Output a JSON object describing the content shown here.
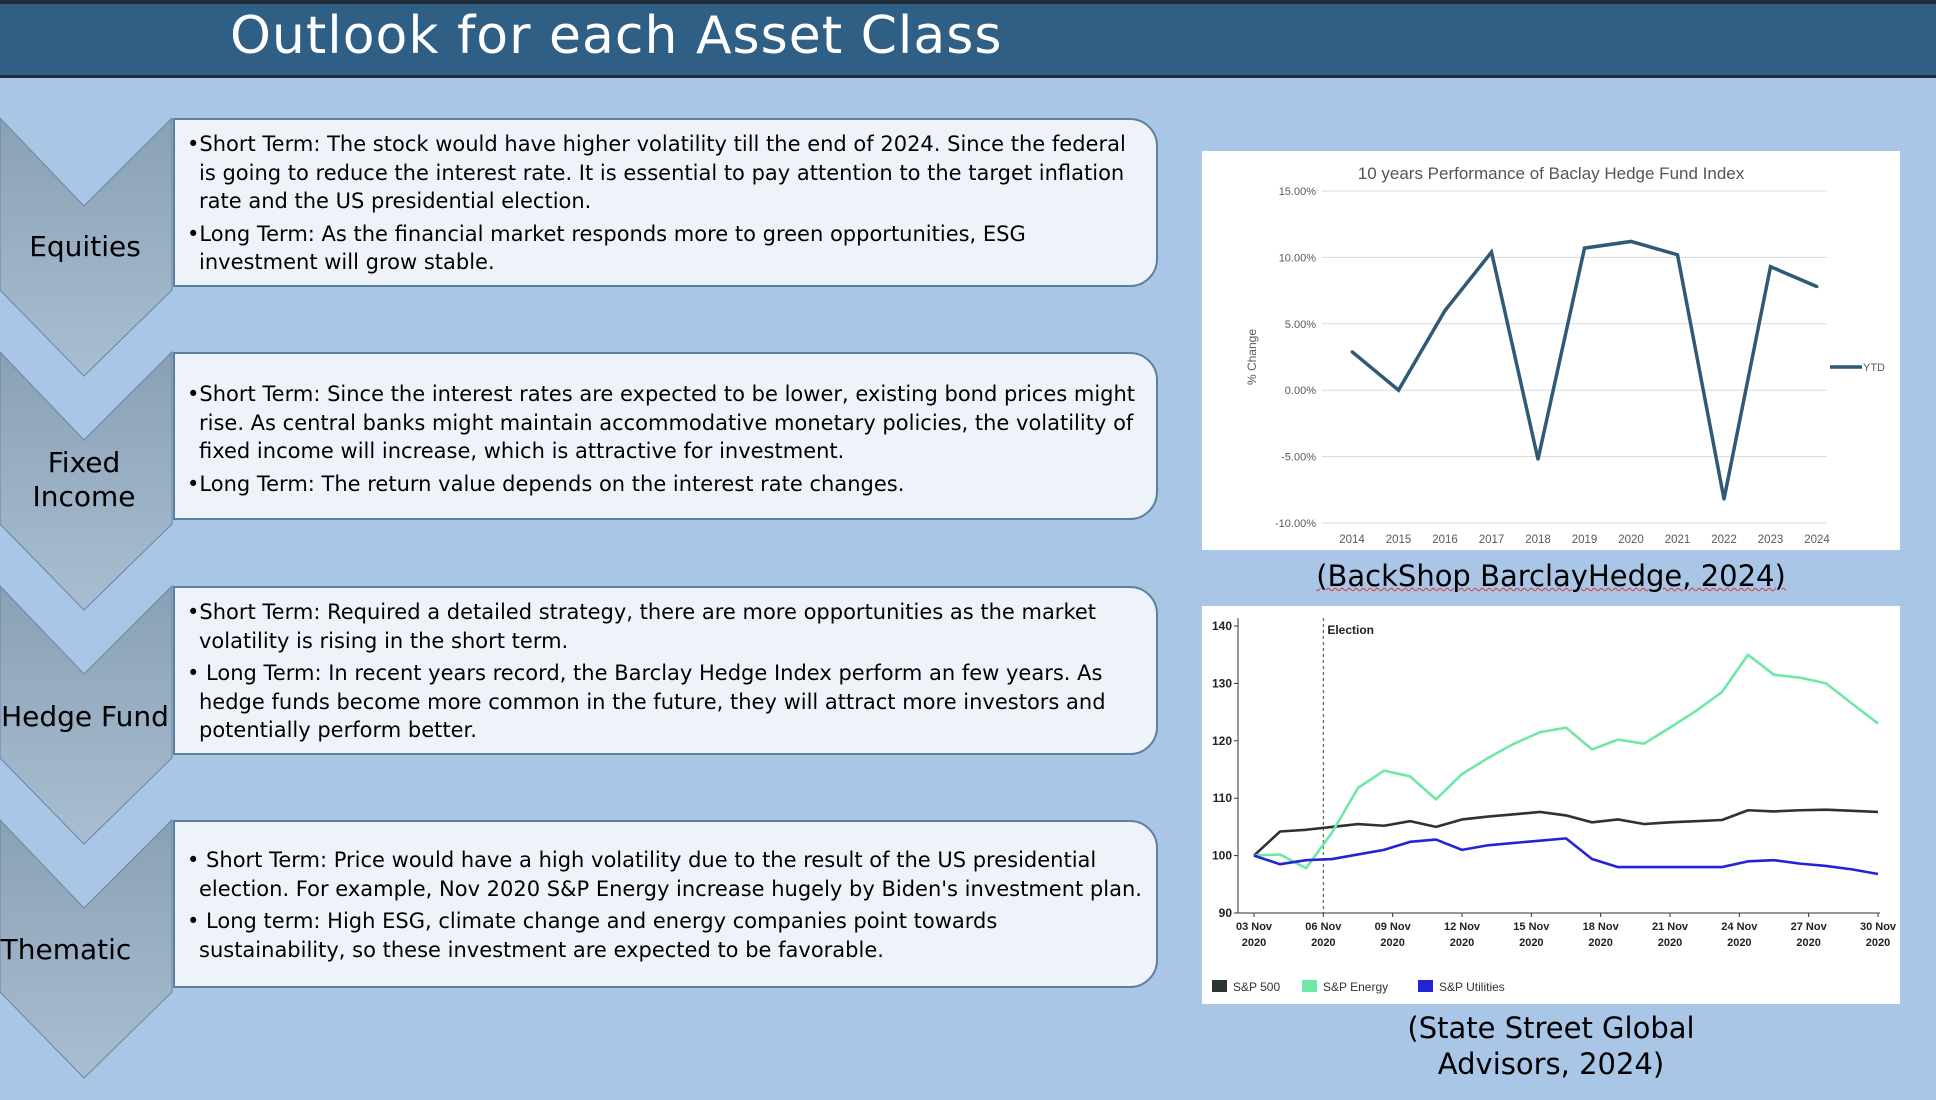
{
  "title": "Outlook for each Asset Class",
  "sections": [
    {
      "label": "Equities",
      "lines": [
        "•Short Term: The stock would have higher volatility till the end of 2024. Since the federal is going to reduce the interest rate. It is essential to pay attention to the target inflation rate and the US presidential election.",
        "•Long Term: As the financial market responds more to green opportunities, ESG investment will grow stable."
      ]
    },
    {
      "label": "Fixed Income",
      "lines": [
        "•Short Term: Since the interest rates are expected to be lower, existing bond prices might rise. As central banks might maintain accommodative monetary policies, the volatility of fixed income will increase, which is attractive for investment.",
        "•Long Term: The return value depends on the interest rate changes."
      ]
    },
    {
      "label": "Hedge Fund",
      "lines": [
        "•Short Term: Required a detailed strategy, there are more opportunities as the market volatility is rising in the short term.",
        "• Long Term: In recent years record, the Barclay Hedge Index perform an few years. As hedge funds become more common in the future, they will attract more investors and potentially perform better."
      ]
    },
    {
      "label": "Thematic",
      "lines": [
        "• Short Term: Price would have a high volatility due to the result of the US presidential election. For example, Nov 2020 S&P Energy increase hugely by Biden's investment plan.",
        "• Long term: High ESG, climate change and energy companies point towards sustainability, so these investment are expected to be favorable."
      ]
    }
  ],
  "captions": {
    "chart1": "(BackShop BarclayHedge, 2024)",
    "chart2": "(State Street Global Advisors, 2024)"
  },
  "colors": {
    "title_bar": "#2f5f85",
    "background": "#a9c6e7",
    "chart1_line": "#2e5a78",
    "sp500": "#2b3530",
    "sp_energy": "#6ee8a6",
    "sp_utilities": "#2424d6"
  },
  "chart_data": [
    {
      "type": "line",
      "title": "10 years Performance of Baclay Hedge Fund Index",
      "ylabel": "% Change",
      "xlabel": "",
      "x": [
        "2014",
        "2015",
        "2016",
        "2017",
        "2018",
        "2019",
        "2020",
        "2021",
        "2022",
        "2023",
        "2024"
      ],
      "series": [
        {
          "name": "YTD",
          "values": [
            2.9,
            0.0,
            6.0,
            10.4,
            -5.2,
            10.7,
            11.2,
            10.2,
            -8.2,
            9.3,
            7.8
          ]
        }
      ],
      "ylim": [
        -10,
        15
      ],
      "yticks": [
        "-10.00%",
        "-5.00%",
        "0.00%",
        "5.00%",
        "10.00%",
        "15.00%"
      ],
      "legend": "right",
      "grid": true
    },
    {
      "type": "line",
      "title": "",
      "xlabel": "",
      "ylabel": "",
      "x": [
        "03 Nov 2020",
        "06 Nov 2020",
        "09 Nov 2020",
        "12 Nov 2020",
        "15 Nov 2020",
        "18 Nov 2020",
        "21 Nov 2020",
        "24 Nov 2020",
        "27 Nov 2020",
        "30 Nov 2020"
      ],
      "annotation": "Election",
      "ylim": [
        90,
        140
      ],
      "yticks": [
        "90",
        "100",
        "110",
        "120",
        "130",
        "140"
      ],
      "legend": "bottom-left",
      "grid": false,
      "series": [
        {
          "name": "S&P 500",
          "values": [
            100,
            104.2,
            104.5,
            105.0,
            105.5,
            105.2,
            106.0,
            105.0,
            106.3,
            106.8,
            107.2,
            107.6,
            107.0,
            105.8,
            106.3,
            105.5,
            105.8,
            106.0,
            106.2,
            107.9,
            107.7,
            107.9,
            108.0,
            107.8,
            107.6
          ]
        },
        {
          "name": "S&P Energy",
          "values": [
            100,
            100.2,
            97.8,
            104.0,
            111.8,
            114.8,
            113.8,
            109.8,
            114.2,
            117.0,
            119.5,
            121.5,
            122.3,
            118.5,
            120.2,
            119.5,
            122.3,
            125.2,
            128.5,
            135.0,
            131.5,
            131.0,
            130.0,
            126.5,
            123.0
          ]
        },
        {
          "name": "S&P Utilities",
          "values": [
            100,
            98.5,
            99.2,
            99.4,
            100.2,
            101.0,
            102.4,
            102.8,
            101.0,
            101.8,
            102.2,
            102.6,
            103.0,
            99.4,
            98.0,
            98.0,
            98.0,
            98.0,
            98.0,
            99.0,
            99.2,
            98.6,
            98.2,
            97.6,
            96.8
          ]
        }
      ]
    }
  ]
}
